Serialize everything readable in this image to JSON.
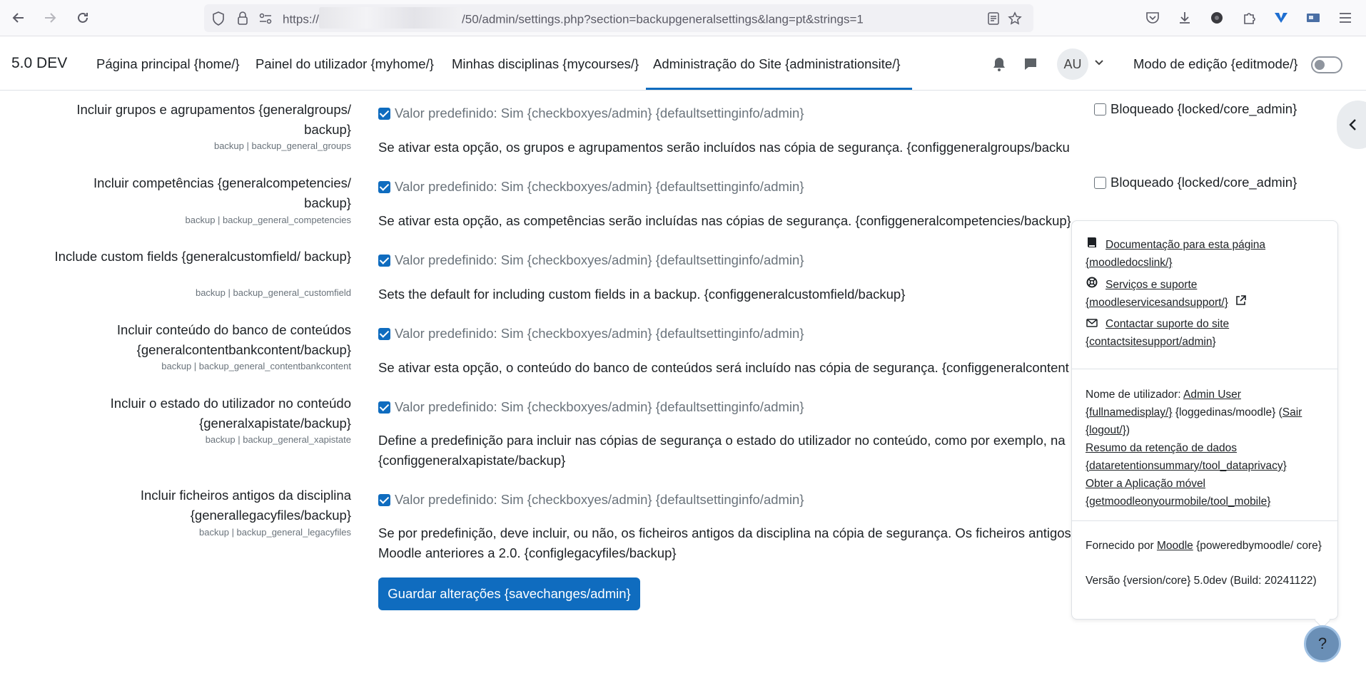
{
  "browser": {
    "url_prefix": "https://",
    "url_suffix": "/50/admin/settings.php?section=backupgeneralsettings&lang=pt&strings=1"
  },
  "navbar": {
    "brand": "5.0 DEV",
    "links": [
      "Página principal {home/}",
      "Painel do utilizador {myhome/}",
      "Minhas disciplinas {mycourses/}",
      "Administração do Site {administrationsite/}"
    ],
    "avatar": "AU",
    "edit_mode": "Modo de edição {editmode/}"
  },
  "settings": [
    {
      "label": "Incluir grupos e agrupamentos {generalgroups/ backup}",
      "sub": "backup | backup_general_groups",
      "default": "Valor predefinido: Sim {checkboxyes/admin} {defaultsettinginfo/admin}",
      "desc": "Se ativar esta opção, os grupos e agrupamentos serão incluídos nas cópia de segurança. {configgeneralgroups/backup}",
      "locked": "Bloqueado {locked/core_admin}"
    },
    {
      "label": "Incluir competências {generalcompetencies/ backup}",
      "sub": "backup | backup_general_competencies",
      "default": "Valor predefinido: Sim {checkboxyes/admin} {defaultsettinginfo/admin}",
      "desc": "Se ativar esta opção, as competências serão incluídas nas cópias de segurança. {configgeneralcompetencies/backup}",
      "locked": "Bloqueado {locked/core_admin}"
    },
    {
      "label": "Include custom fields {generalcustomfield/ backup}",
      "sub": "backup | backup_general_customfield",
      "default": "Valor predefinido: Sim {checkboxyes/admin} {defaultsettinginfo/admin}",
      "desc": "Sets the default for including custom fields in a backup. {configgeneralcustomfield/backup}"
    },
    {
      "label": "Incluir conteúdo do banco de conteúdos {generalcontentbankcontent/backup}",
      "sub": "backup | backup_general_contentbankcontent",
      "default": "Valor predefinido: Sim {checkboxyes/admin} {defaultsettinginfo/admin}",
      "desc": "Se ativar esta opção, o conteúdo do banco de conteúdos será incluído nas cópia de segurança. {configgeneralcontent"
    },
    {
      "label": "Incluir o estado do utilizador no conteúdo {generalxapistate/backup}",
      "sub": "backup | backup_general_xapistate",
      "default": "Valor predefinido: Sim {checkboxyes/admin} {defaultsettinginfo/admin}",
      "desc": "Define a predefinição para incluir nas cópias de segurança o estado do utilizador no conteúdo, como por exemplo, na",
      "desc2": "{configgeneralxapistate/backup}"
    },
    {
      "label": "Incluir ficheiros antigos da disciplina {generallegacyfiles/backup}",
      "sub": "backup | backup_general_legacyfiles",
      "default": "Valor predefinido: Sim {checkboxyes/admin} {defaultsettinginfo/admin}",
      "desc": "Se por predefinição, deve incluir, ou não, os ficheiros antigos da disciplina na cópia de segurança. Os ficheiros antigos",
      "desc2": "Moodle anteriores a 2.0. {configlegacyfiles/backup}"
    }
  ],
  "save_button": "Guardar alterações {savechanges/admin}",
  "popover": {
    "docs_link": "Documentação para esta página {moodledocslink/}",
    "services_link": "Serviços e suporte {moodleservicesandsupport/}",
    "contact_link": "Contactar suporte do site {contactsitesupport/admin}",
    "user_prefix": "Nome de utilizador:",
    "user_name": "Admin User {fullnamedisplay/}",
    "loggedin": "{loggedinas/moodle}",
    "logout": "Sair {logout/}",
    "retention": "Resumo da retenção de dados {dataretentionsummary/tool_dataprivacy}",
    "mobile": "Obter a Aplicação móvel {getmoodleonyourmobile/tool_mobile}",
    "powered_prefix": "Fornecido por",
    "powered_link": "Moodle",
    "powered_suffix": "{poweredbymoodle/ core}",
    "version": "Versão {version/core} 5.0dev (Build: 20241122)"
  },
  "help_button": "?"
}
